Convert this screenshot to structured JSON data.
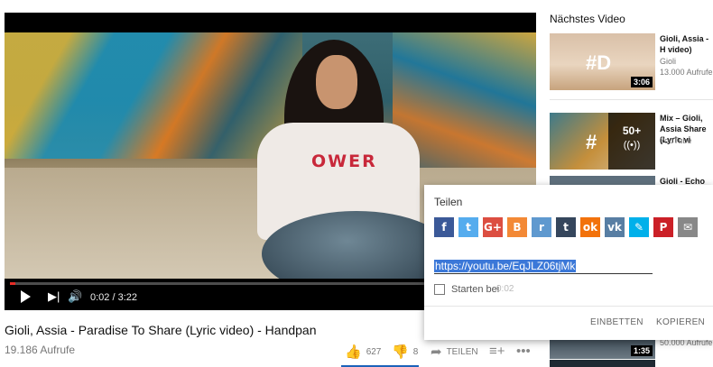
{
  "player": {
    "shirt_text": "OWER",
    "time": "0:02 / 3:22",
    "progress_fraction": 0.01
  },
  "video": {
    "title": "Gioli, Assia - Paradise To Share (Lyric video) - Handpan",
    "views": "19.186 Aufrufe",
    "likes": "627",
    "dislikes": "8",
    "share_label": "TEILEN"
  },
  "sidebar": {
    "heading": "Nächstes Video",
    "items": [
      {
        "title": "Gioli, Assia - H video)",
        "channel": "Gioli",
        "views": "13.000 Aufrufe",
        "duration": "3:06"
      },
      {
        "title": "Mix – Gioli, Assia Share (Lyric vi",
        "channel": "YouTube",
        "mix_count": "50+"
      },
      {
        "title": "Gioli - Echo of"
      },
      {
        "views": "50.000 Aufrufe",
        "duration": "1:35"
      }
    ]
  },
  "share_dialog": {
    "title": "Teilen",
    "url": "https://youtu.be/EqJLZ06tjMk",
    "start_label": "Starten bei",
    "start_time": "0:02",
    "embed_label": "EINBETTEN",
    "copy_label": "KOPIEREN",
    "socials": [
      {
        "name": "facebook-icon",
        "glyph": "f",
        "color": "#3b5998"
      },
      {
        "name": "twitter-icon",
        "glyph": "t",
        "color": "#55acee"
      },
      {
        "name": "google-plus-icon",
        "glyph": "G+",
        "color": "#dc4e41"
      },
      {
        "name": "blogger-icon",
        "glyph": "B",
        "color": "#f38936"
      },
      {
        "name": "reddit-icon",
        "glyph": "r",
        "color": "#5f99cf"
      },
      {
        "name": "tumblr-icon",
        "glyph": "t",
        "color": "#35465c"
      },
      {
        "name": "odnoklassniki-icon",
        "glyph": "ok",
        "color": "#f2720c"
      },
      {
        "name": "vk-icon",
        "glyph": "vk",
        "color": "#587ea3"
      },
      {
        "name": "livejournal-icon",
        "glyph": "✎",
        "color": "#00b0ea"
      },
      {
        "name": "pinterest-icon",
        "glyph": "P",
        "color": "#cb2027"
      },
      {
        "name": "email-icon",
        "glyph": "✉",
        "color": "#888888"
      }
    ]
  }
}
